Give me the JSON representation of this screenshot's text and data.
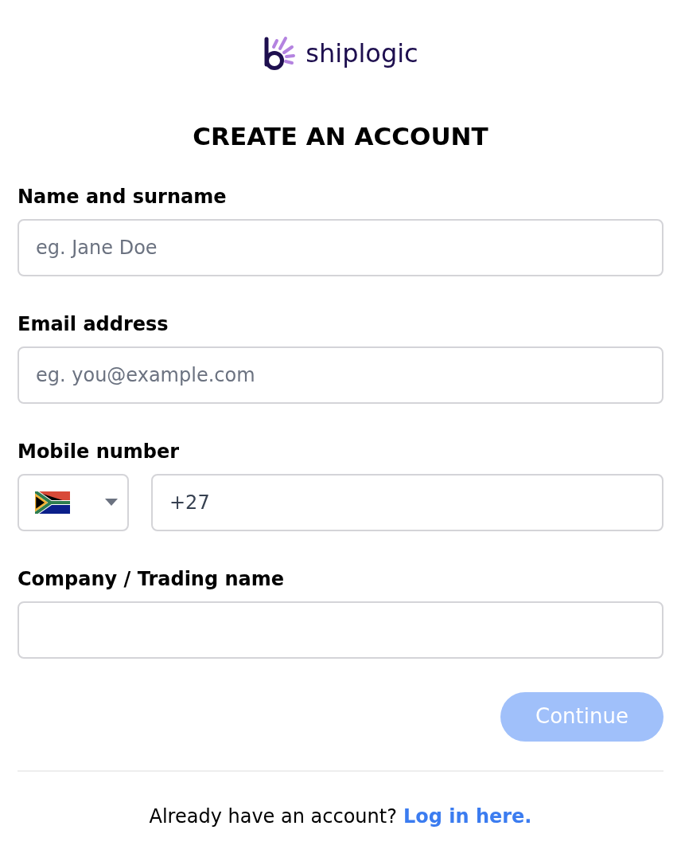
{
  "logo": {
    "text": "shiplogic"
  },
  "title": "CREATE AN ACCOUNT",
  "fields": [
    {
      "kind": "text",
      "label": "Name and surname",
      "placeholder": "eg. Jane Doe"
    },
    {
      "kind": "text",
      "label": "Email address",
      "placeholder": "eg. you@example.com"
    },
    {
      "kind": "phone",
      "label": "Mobile number",
      "value": "+27"
    },
    {
      "kind": "text",
      "label": "Company / Trading name"
    }
  ],
  "continue_button": {
    "label": "Continue",
    "disabled": true
  },
  "footer": {
    "text": "Already have an account?",
    "link": "Log in here."
  }
}
